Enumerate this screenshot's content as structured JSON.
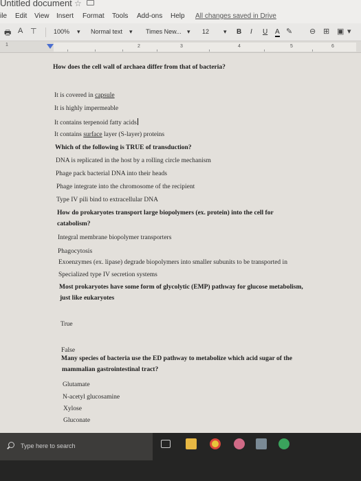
{
  "window": {
    "title": "Untitled document",
    "save_status": "All changes saved in Drive"
  },
  "menu": {
    "items": [
      "ile",
      "Edit",
      "View",
      "Insert",
      "Format",
      "Tools",
      "Add-ons",
      "Help"
    ]
  },
  "toolbar": {
    "zoom": "100%",
    "style": "Normal text",
    "font": "Times New...",
    "font_size": "12",
    "bold": "B",
    "italic": "I",
    "underline": "U",
    "text_color": "A"
  },
  "ruler": {
    "numbers": [
      "1",
      "2",
      "3",
      "4",
      "5",
      "6"
    ]
  },
  "document": {
    "heading": "How does the cell wall of archaea differ from that of bacteria?",
    "q1_options": {
      "a_pre": "It is covered in ",
      "a_ul": "capsule",
      "b": "It is highly impermeable",
      "c": "It contains terpenoid fatty acids",
      "d_pre": "It contains ",
      "d_ul": "surface",
      "d_post": " layer (S-layer) proteins"
    },
    "q2": "Which of the following is TRUE of transduction?",
    "q2_options": [
      "DNA is replicated in the host by a rolling circle mechanism",
      "Phage pack bacterial DNA into their heads",
      "Phage integrate into the chromosome of the recipient",
      "Type IV pili bind to extracellular DNA"
    ],
    "q3_line1": "How do prokaryotes transport large biopolymers (ex. protein) into the cell for",
    "q3_line2": "catabolism?",
    "q3_options": [
      "Integral membrane biopolymer transporters",
      "Phagocytosis",
      "Exoenzymes (ex. lipase) degrade biopolymers into smaller subunits to be transported in",
      "Specialized type IV secretion systems"
    ],
    "q4_line1": "Most prokaryotes have some form of glycolytic (EMP) pathway for glucose metabolism,",
    "q4_line2": "just like eukaryotes",
    "q4_options": [
      "True",
      "False"
    ],
    "q5_line1": "Many species of bacteria use the ED pathway to metabolize which acid sugar of the",
    "q5_line2": "mammalian gastrointestinal tract?",
    "q5_options": [
      "Glutamate",
      "N-acetyl glucosamine",
      "Xylose",
      "Gluconate"
    ]
  },
  "taskbar": {
    "search_placeholder": "Type here to search"
  }
}
